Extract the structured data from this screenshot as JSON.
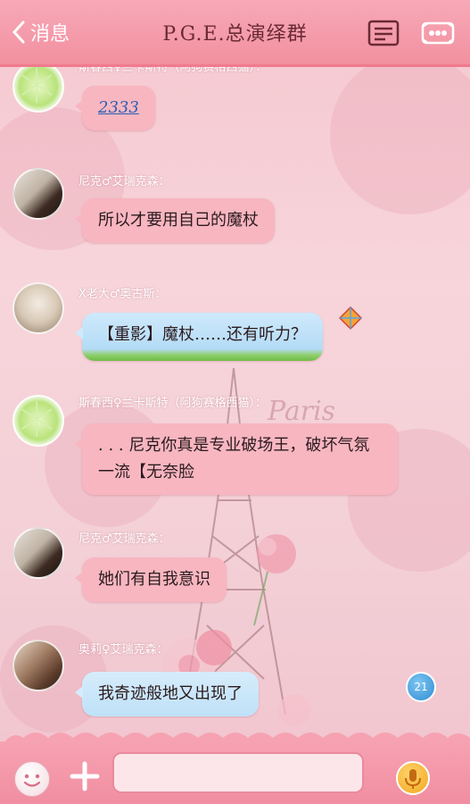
{
  "header": {
    "back_label": "消息",
    "title": "P.G.E.总演绎群"
  },
  "messages": [
    {
      "sender": "斯春西♀兰卡斯特（阿狗赛格西猫）：",
      "text": "2333",
      "avatar": "lime-slice-avatar",
      "is_link": true
    },
    {
      "sender": "尼克♂艾瑞克森：",
      "text": "所以才要用自己的魔杖",
      "avatar": "piano-room-avatar"
    },
    {
      "sender": "X老大♂奥古斯：",
      "text": "【重影】魔杖……还有听力？",
      "avatar": "anime-boy-avatar",
      "style": "blue-grass"
    },
    {
      "sender": "斯春西♀兰卡斯特（阿狗赛格西猫）：",
      "text": ". . . 尼克你真是专业破场王，破坏气氛一流【无奈脸",
      "avatar": "lime-slice-avatar"
    },
    {
      "sender": "尼克♂艾瑞克森：",
      "text": "她们有自我意识",
      "avatar": "piano-room-avatar"
    },
    {
      "sender": "奥莉♀艾瑞克森：",
      "text": "我奇迹般地又出现了",
      "avatar": "couple-avatar",
      "style": "blue-cloud"
    }
  ],
  "unread_badge": "21",
  "composer": {
    "input_value": "",
    "emoji_icon": "smiley-icon",
    "plus_icon": "plus-icon",
    "mic_icon": "microphone-icon"
  },
  "colors": {
    "header": "#f2909f",
    "bubble": "#f7b6c0",
    "bubble_blue": "#cfe9fb",
    "background": "#f6d3da"
  }
}
